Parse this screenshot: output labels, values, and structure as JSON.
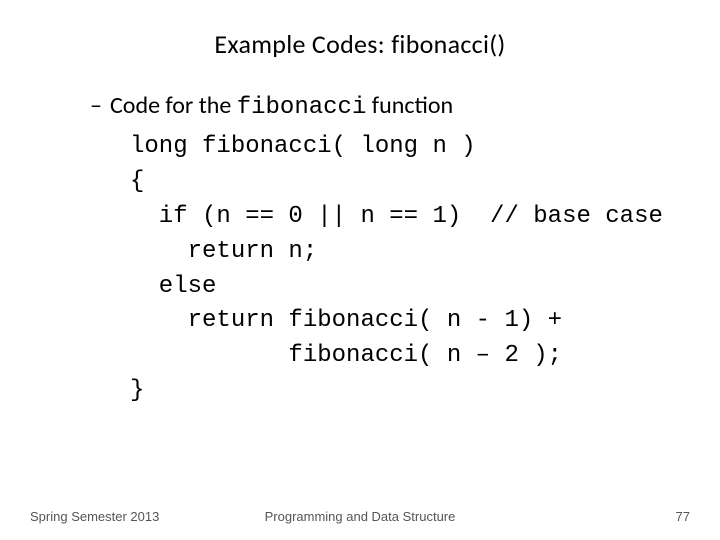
{
  "title": "Example Codes: fibonacci()",
  "bullet": {
    "dash": "–",
    "pre": "Code for the ",
    "mono": "fibonacci",
    "post": " function"
  },
  "code": "long fibonacci( long n )\n{\n  if (n == 0 || n == 1)  // base case\n    return n;\n  else\n    return fibonacci( n - 1) +\n           fibonacci( n – 2 );\n}",
  "footer": {
    "left": "Spring Semester 2013",
    "center": "Programming and Data Structure",
    "right": "77"
  }
}
